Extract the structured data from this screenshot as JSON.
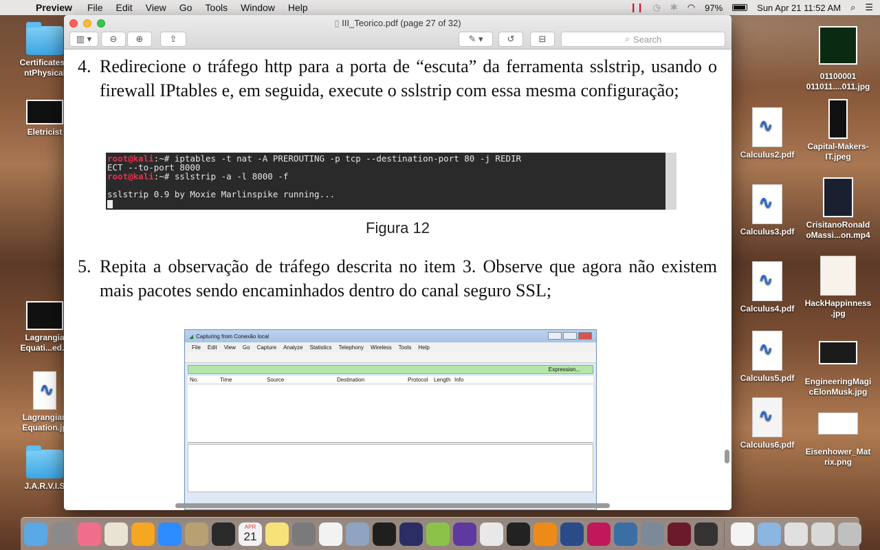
{
  "menubar": {
    "app_name": "Preview",
    "menus": [
      "File",
      "Edit",
      "View",
      "Go",
      "Tools",
      "Window",
      "Help"
    ],
    "battery": "97%",
    "datetime": "Sun Apr 21  11:52 AM"
  },
  "window": {
    "title": "III_Teorico.pdf (page 27 of 32)",
    "search_placeholder": "Search"
  },
  "document": {
    "item4_num": "4.",
    "item4_text": "Redirecione o tráfego http para a porta de “escuta” da ferramenta sslstrip, usando o firewall IPtables e, em seguida, execute o sslstrip com essa mesma configuração;",
    "term_prompt": "root@kali",
    "term_line1": ":~# iptables -t nat -A PREROUTING -p tcp --destination-port 80 -j REDIR",
    "term_line2": "ECT --to-port 8000",
    "term_line3": ":~# sslstrip -a -l 8000 -f",
    "term_line4": "sslstrip 0.9 by Moxie Marlinspike running...",
    "caption": "Figura 12",
    "item5_num": "5.",
    "item5_text": "Repita a observação de tráfego descrita no item 3. Observe que agora não existem mais pacotes sendo encaminhados dentro do canal seguro SSL;"
  },
  "wireshark": {
    "title": "Capturing from Conexão local",
    "menus": [
      "File",
      "Edit",
      "View",
      "Go",
      "Capture",
      "Analyze",
      "Statistics",
      "Telephony",
      "Wireless",
      "Tools",
      "Help"
    ],
    "filter_expression": "Expression...",
    "columns": [
      "No.",
      "Time",
      "Source",
      "Destination",
      "Protocol",
      "Length",
      "Info"
    ]
  },
  "desktop_left": [
    {
      "label": "CertificatesT ntPhysical"
    },
    {
      "label": "Eletricist"
    },
    {
      "label": "Lagrangia Equati...ed.p"
    },
    {
      "label": "Lagrangian Equation.jp"
    },
    {
      "label": "J.A.R.V.I.S"
    }
  ],
  "desktop_right": [
    {
      "label": "01100001 011011....011.jpg"
    },
    {
      "label": "Calculus2.pdf"
    },
    {
      "label": "Capital-Makers-IT.jpeg"
    },
    {
      "label": "Calculus3.pdf"
    },
    {
      "label": "CrisitanoRonald oMassi...on.mp4"
    },
    {
      "label": "Calculus4.pdf"
    },
    {
      "label": "HackHappinness .jpg"
    },
    {
      "label": "Calculus5.pdf"
    },
    {
      "label": "EngineeringMagi cElonMusk.jpg"
    },
    {
      "label": "Calculus6.pdf"
    },
    {
      "label": "Eisenhower_Mat rix.png"
    }
  ],
  "dock": {
    "calendar_month": "APR",
    "calendar_day": "21",
    "colors": [
      "#5aa8e6",
      "#8a8a8a",
      "#f06e8a",
      "#e9e3d4",
      "#f5a623",
      "#2d8cff",
      "#b8a070",
      "#2a2a2a",
      "#f2f2f2",
      "#f7e27a",
      "#7a7a7a",
      "#f2f2f2",
      "#8fa4c2",
      "#1f1f1f",
      "#2b2e63",
      "#8bc34a",
      "#5e3aa0",
      "#e8e8e8",
      "#222222",
      "#ee8a1a",
      "#2a4a8a",
      "#c2185b",
      "#3a6ea5",
      "#7a8a9a",
      "#6a1a2a",
      "#333333",
      "#f4f4f4",
      "#8ab6e0",
      "#e0e0e0",
      "#d8d8d8",
      "#c0c0c0"
    ]
  }
}
